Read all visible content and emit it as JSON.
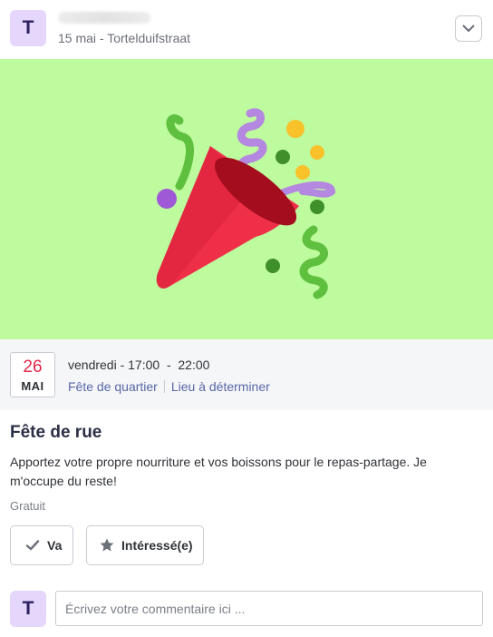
{
  "post": {
    "author_initial": "T",
    "meta": "15 mai - Tortelduifstraat",
    "menu_icon": "chevron-down-icon"
  },
  "banner": {
    "background": "#bdfb9e",
    "image": "party-popper-icon"
  },
  "event": {
    "day": "26",
    "month": "MAI",
    "time": "vendredi - 17:00  -  22:00",
    "category": "Fête de quartier",
    "location": "Lieu à déterminer",
    "title": "Fête de rue",
    "description": "Apportez votre propre nourriture et vos boissons pour le repas-partage. Je m'occupe du reste!",
    "price": "Gratuit"
  },
  "actions": {
    "go_label": "Va",
    "go_icon": "checkmark-icon",
    "interested_label": "Intéressé(e)",
    "interested_icon": "star-icon"
  },
  "comment": {
    "avatar_initial": "T",
    "placeholder": "Écrivez votre commentaire ici ..."
  },
  "colors": {
    "avatar_bg": "#e4d7fb",
    "date_red": "#e02748",
    "link_blue": "#5866a6"
  }
}
